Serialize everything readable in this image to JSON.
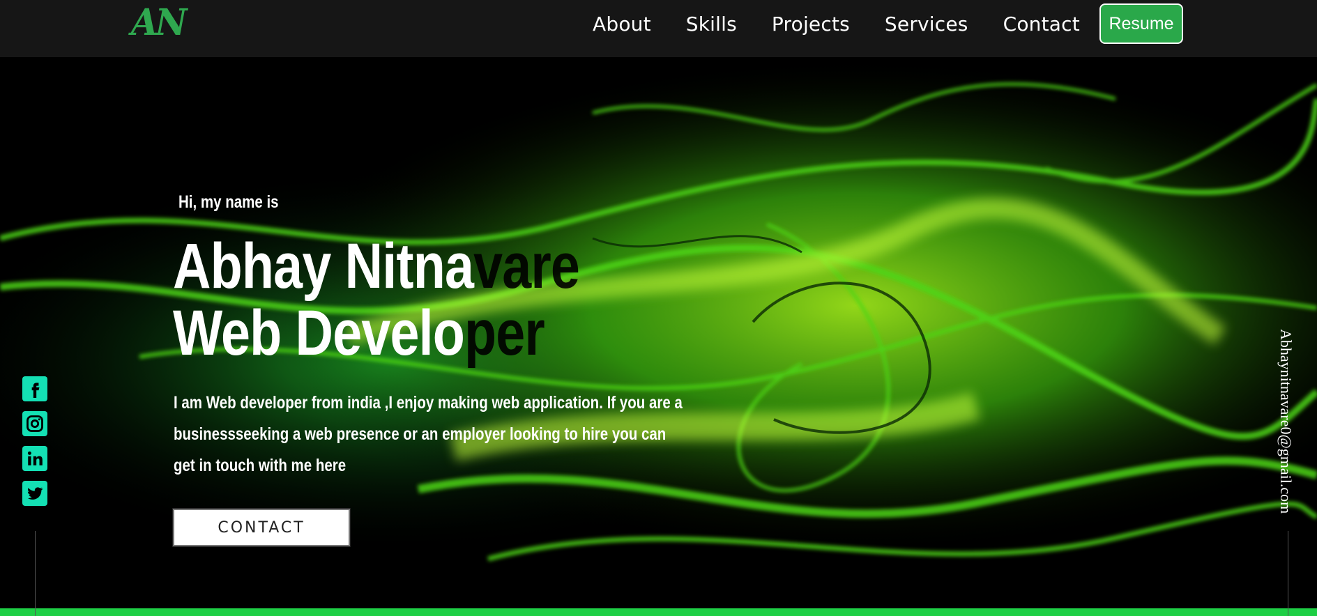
{
  "logo": "AN",
  "nav": {
    "links": [
      "About",
      "Skills",
      "Projects",
      "Services",
      "Contact"
    ],
    "resume_label": "Resume"
  },
  "hero": {
    "greeting": "Hi, my name is",
    "name_lit": "Abhay Nitna",
    "name_dim": "vare",
    "role_lit": "Web Develo",
    "role_dim": "per",
    "bio": "I am Web developer from india ,I enjoy making web application. If you are a businessseeking a web presence or an employer looking to hire you can get in touch with me here",
    "contact_label": "CONTACT"
  },
  "social": {
    "icons": [
      "facebook-icon",
      "instagram-icon",
      "linkedin-icon",
      "twitter-icon"
    ]
  },
  "email": "Abhaynitnavare0@gmail.com",
  "colors": {
    "accent": "#2aa84a",
    "social": "#14e0b4",
    "bar": "#1ecf45",
    "navbar": "#161616"
  }
}
